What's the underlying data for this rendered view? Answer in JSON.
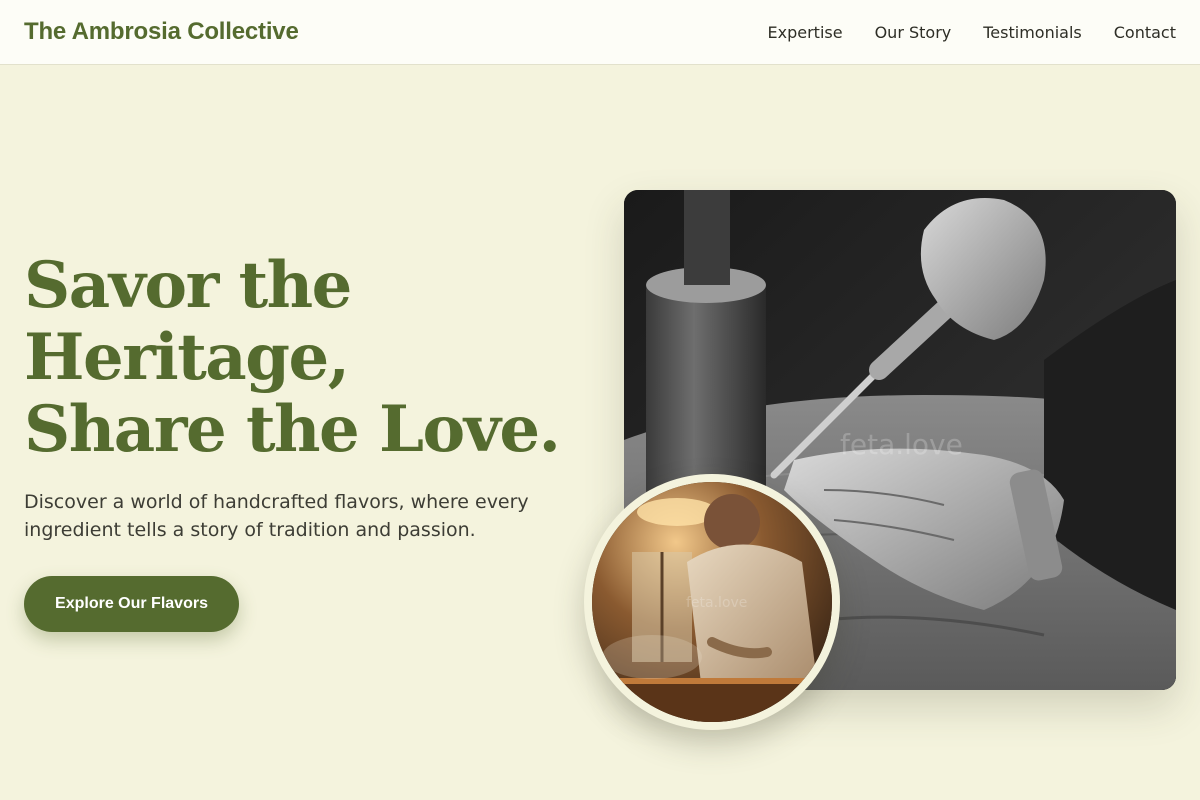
{
  "header": {
    "brand": "The Ambrosia Collective",
    "nav": [
      "Expertise",
      "Our Story",
      "Testimonials",
      "Contact"
    ]
  },
  "hero": {
    "title_lines": [
      "Savor the",
      "Heritage,",
      "Share the Love."
    ],
    "subtitle": "Discover a world of handcrafted flavors, where every ingredient tells a story of tradition and passion.",
    "cta_label": "Explore Our Flavors"
  },
  "images": {
    "main_watermark": "feta.love",
    "round_watermark": "feta.love"
  },
  "colors": {
    "background": "#f4f3dd",
    "accent": "#556b2f",
    "header_bg": "#fdfdf7"
  }
}
